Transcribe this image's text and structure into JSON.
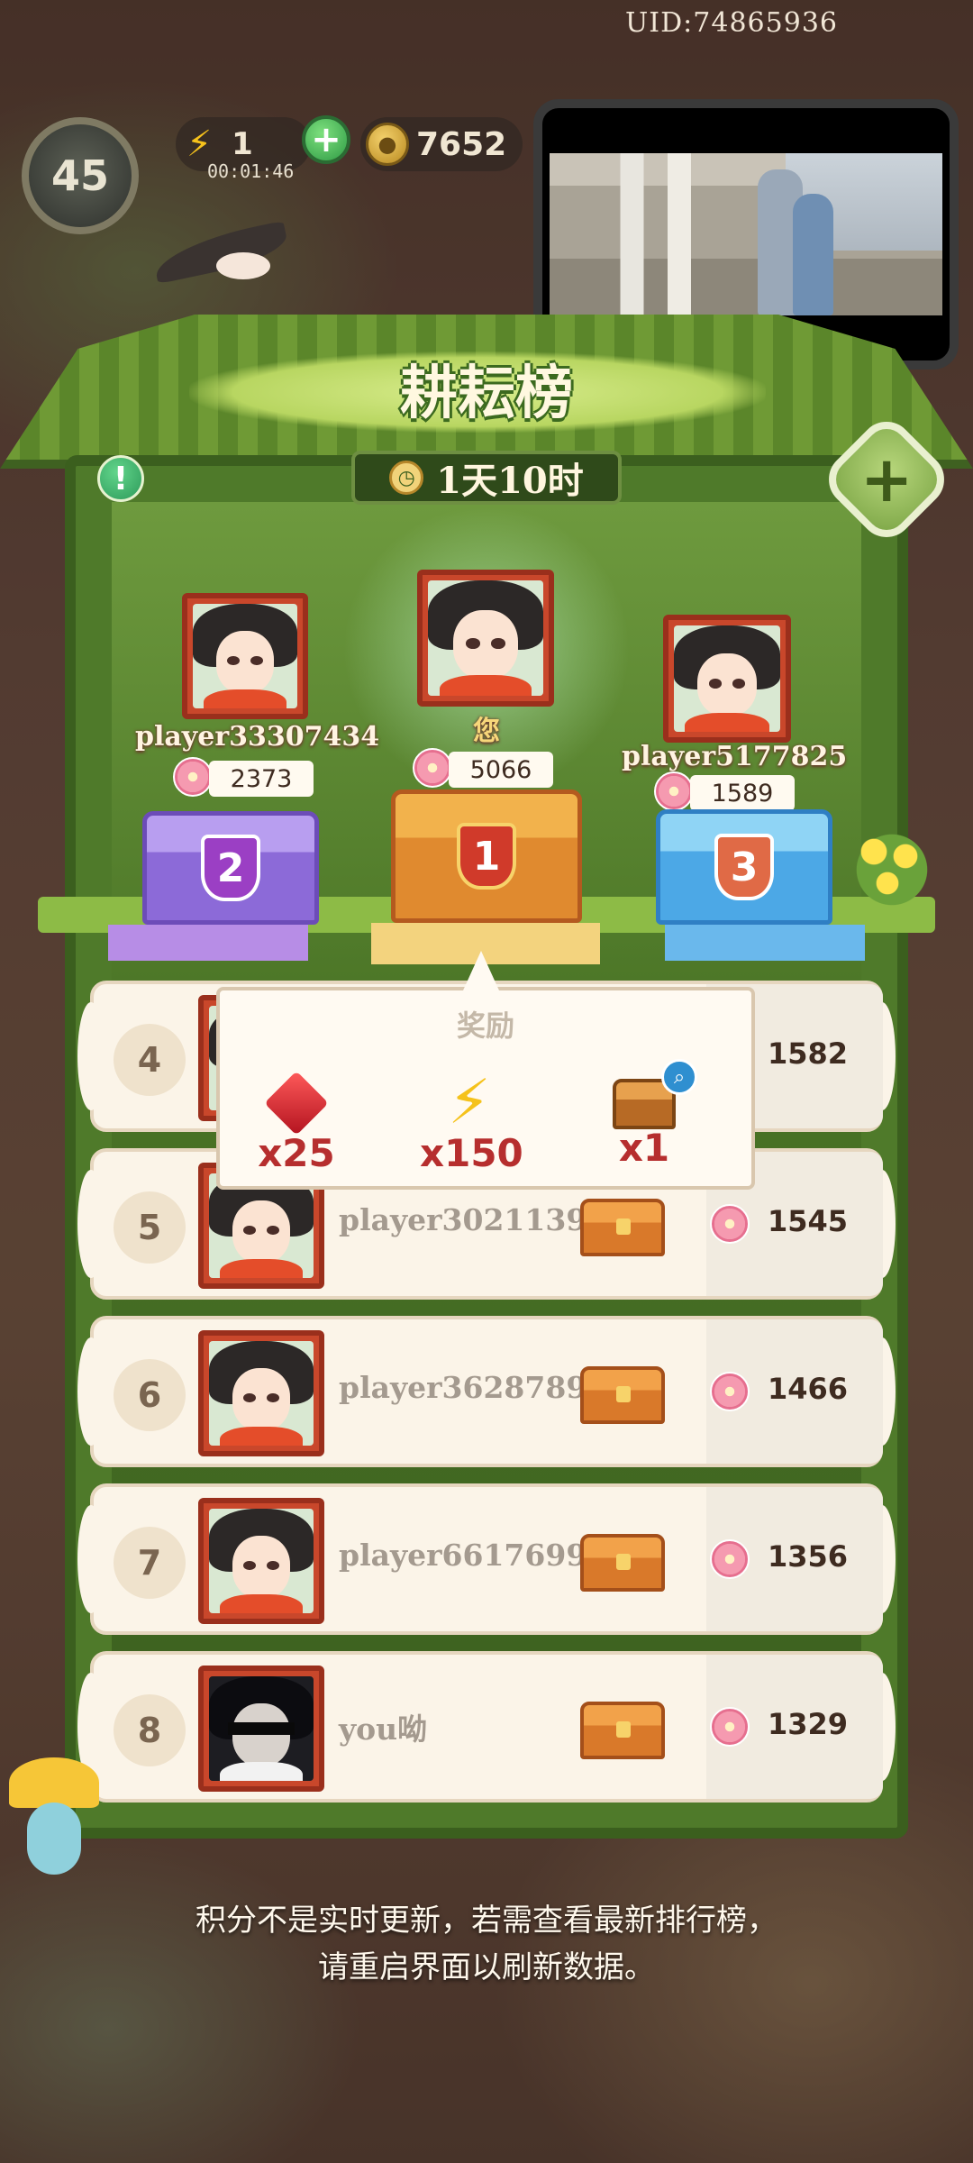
{
  "hud": {
    "uid": "UID:74865936",
    "level": "45",
    "energy": "1",
    "energy_timer": "00:01:46",
    "coins": "7652"
  },
  "leaderboard": {
    "title": "耕耘榜",
    "time_left": "1天10时",
    "podium": [
      {
        "rank": "2",
        "name": "player33307434",
        "score": "2373",
        "color": "purple"
      },
      {
        "rank": "1",
        "name": "您",
        "score": "5066",
        "color": "gold"
      },
      {
        "rank": "3",
        "name": "player5177825",
        "score": "1589",
        "color": "blue"
      }
    ],
    "rows": [
      {
        "rank": "4",
        "name": "",
        "score": "1582"
      },
      {
        "rank": "5",
        "name": "player30211399",
        "score": "1545"
      },
      {
        "rank": "6",
        "name": "player36287895",
        "score": "1466"
      },
      {
        "rank": "7",
        "name": "player66176994",
        "score": "1356"
      },
      {
        "rank": "8",
        "name": "you呦",
        "score": "1329"
      }
    ]
  },
  "reward_popup": {
    "title": "奖励",
    "items": [
      {
        "icon": "ruby-icon",
        "amount": "x25"
      },
      {
        "icon": "energy-bolt-icon",
        "amount": "x150"
      },
      {
        "icon": "treasure-chest-icon",
        "amount": "x1"
      }
    ]
  },
  "notice": {
    "line1": "积分不是实时更新，若需查看最新排行榜，",
    "line2": "请重启界面以刷新数据。"
  }
}
